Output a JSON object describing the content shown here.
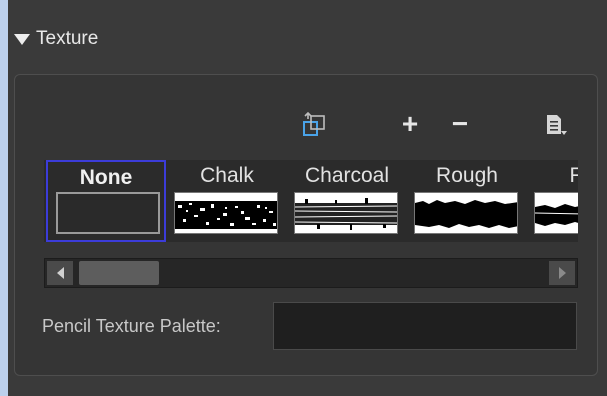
{
  "section": {
    "title": "Texture"
  },
  "toolbar": {
    "buttons": [
      {
        "name": "import-texture",
        "glyph": "",
        "icon": "import-icon"
      },
      {
        "name": "add",
        "glyph": "+",
        "icon": "plus-icon"
      },
      {
        "name": "remove",
        "glyph": "−",
        "icon": "minus-icon"
      },
      {
        "name": "menu",
        "glyph": "",
        "icon": "menu-icon"
      }
    ]
  },
  "textures": [
    {
      "label": "None",
      "selected": true,
      "style": "none"
    },
    {
      "label": "Chalk",
      "selected": false,
      "style": "chalk"
    },
    {
      "label": "Charcoal",
      "selected": false,
      "style": "charcoal"
    },
    {
      "label": "Rough",
      "selected": false,
      "style": "rough"
    },
    {
      "label": "Felt",
      "selected": false,
      "style": "felt"
    }
  ],
  "scrollbar": {
    "position": 0
  },
  "palette": {
    "label": "Pencil Texture Palette:",
    "value": ""
  },
  "colors": {
    "selection": "#3c3cd9",
    "panel": "#3a3a3a",
    "sidebar": "#bcd0ec"
  }
}
